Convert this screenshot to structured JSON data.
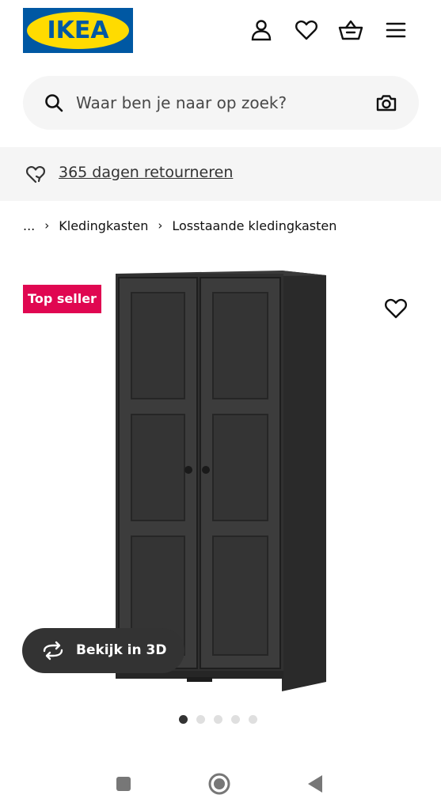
{
  "header": {
    "logo_text": "IKEA",
    "brand_colors": {
      "blue": "#0058a3",
      "yellow": "#ffdb00"
    },
    "icons": [
      "profile-icon",
      "heart-icon",
      "basket-icon",
      "menu-icon"
    ]
  },
  "search": {
    "placeholder": "Waar ben je naar op zoek?",
    "icons": [
      "search-icon",
      "camera-icon"
    ]
  },
  "banner": {
    "text": "365 dagen retourneren",
    "icon": "return-heart-icon"
  },
  "breadcrumb": {
    "items": [
      "...",
      "Kledingkasten",
      "Losstaande kledingkasten"
    ]
  },
  "product": {
    "badge": "Top seller",
    "badge_color": "#e00751",
    "view3d_label": "Bekijk in 3D",
    "image": "black wardrobe with two doors",
    "carousel": {
      "count": 5,
      "active": 1
    }
  },
  "system_nav": {
    "buttons": [
      "recent-apps",
      "home",
      "back"
    ]
  }
}
